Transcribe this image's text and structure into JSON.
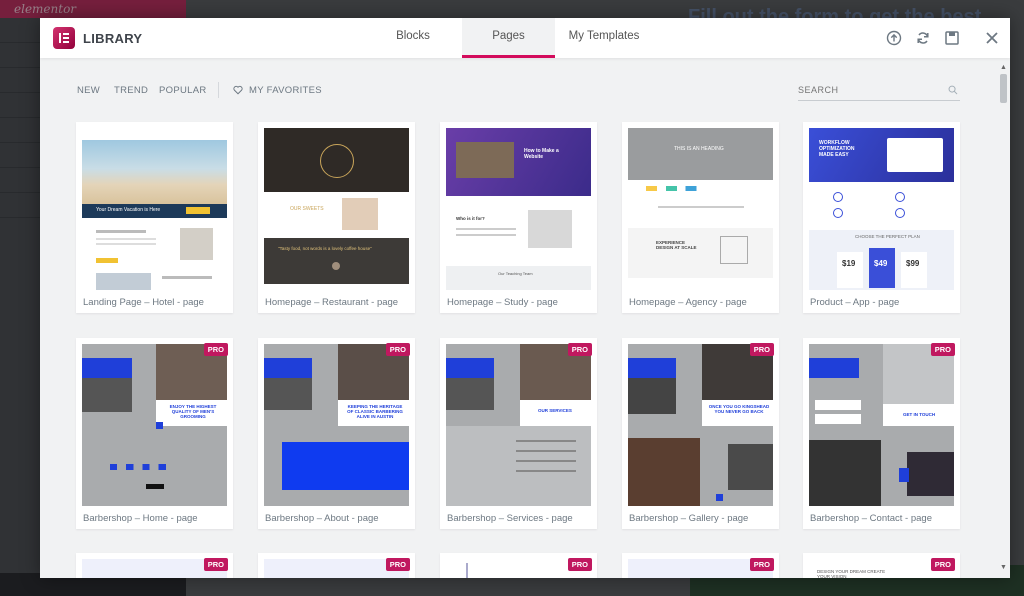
{
  "background": {
    "brand_text": "elementor",
    "heading_text": "Fill out the form to get the best"
  },
  "modal": {
    "title": "LIBRARY",
    "tabs": [
      {
        "label": "Blocks",
        "active": false
      },
      {
        "label": "Pages",
        "active": true
      },
      {
        "label": "My Templates",
        "active": false
      }
    ],
    "header_icons": [
      "upload-icon",
      "sync-icon",
      "save-icon",
      "close-icon"
    ],
    "accent_color": "#d30c5c"
  },
  "filters": {
    "items": [
      "NEW",
      "TREND",
      "POPULAR"
    ],
    "favorites": "MY FAVORITES",
    "search_placeholder": "SEARCH"
  },
  "templates_row1": [
    {
      "caption": "Landing Page – Hotel - page",
      "pro": false
    },
    {
      "caption": "Homepage – Restaurant - page",
      "pro": false
    },
    {
      "caption": "Homepage – Study - page",
      "pro": false
    },
    {
      "caption": "Homepage – Agency - page",
      "pro": false
    },
    {
      "caption": "Product – App - page",
      "pro": false
    }
  ],
  "templates_row2": [
    {
      "caption": "Barbershop – Home - page",
      "pro": true
    },
    {
      "caption": "Barbershop – About - page",
      "pro": true
    },
    {
      "caption": "Barbershop – Services - page",
      "pro": true
    },
    {
      "caption": "Barbershop – Gallery - page",
      "pro": true
    },
    {
      "caption": "Barbershop – Contact - page",
      "pro": true
    }
  ],
  "templates_row3": [
    {
      "pro": true
    },
    {
      "pro": true
    },
    {
      "pro": true
    },
    {
      "pro": true
    },
    {
      "pro": true
    }
  ],
  "pro_badge": "PRO",
  "thumb_text": {
    "hotel_tagline": "Your Dream Vacation is Here",
    "restaurant_name": "OUR SWEETS",
    "restaurant_quote": "\"Tasty food, not words is a lovely coffee house\"",
    "study_title": "How to Make a Website",
    "study_who": "Who is it for?",
    "study_teachers": "Our Teaching Team",
    "agency_heading": "THIS IS AN HEADING",
    "agency_design": "EXPERIENCE DESIGN AT SCALE",
    "app_title": "WORKFLOW OPTIMIZATION MADE EASY",
    "app_plan": "CHOOSE THE PERFECT PLAN",
    "app_prices": [
      "$19",
      "$49",
      "$99"
    ],
    "barber_home": "ENJOY THE HIGHEST QUALITY OF MEN'S GROOMING",
    "barber_about": "KEEPING THE HERITAGE OF CLASSIC BARBERING ALIVE IN AUSTIN",
    "barber_services": "OUR SERVICES",
    "barber_gallery": "ONCE YOU GO KINGSHEAD YOU NEVER GO BACK",
    "barber_contact": "GET IN TOUCH",
    "row3_text": "DESIGN YOUR DREAM CREATE YOUR VISION"
  }
}
